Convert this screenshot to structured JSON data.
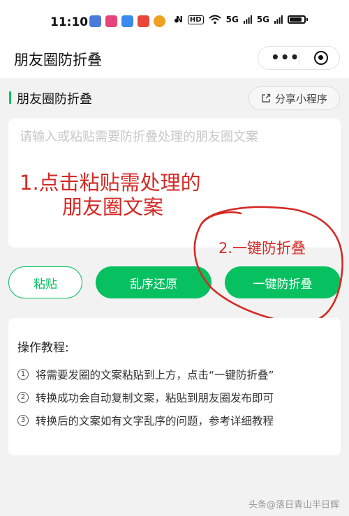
{
  "status": {
    "time": "11:10",
    "right_items": [
      "N",
      "HD",
      "5G",
      "5G"
    ]
  },
  "nav": {
    "title": "朋友圈防折叠",
    "menu_dots": "•••"
  },
  "section": {
    "title": "朋友圈防折叠",
    "share_label": "分享小程序"
  },
  "input": {
    "placeholder": "请输入或粘贴需要防折叠处理的朋友圈文案"
  },
  "annotations": {
    "step1_line1": "1.点击粘贴需处理的",
    "step1_line2": "朋友圈文案",
    "step2": "2.一键防折叠"
  },
  "buttons": {
    "paste": "粘贴",
    "restore": "乱序还原",
    "fold": "一键防折叠"
  },
  "tutorial": {
    "title": "操作教程:",
    "steps": [
      {
        "num": "1",
        "text": "将需要发圈的文案粘贴到上方，点击“一键防折叠”"
      },
      {
        "num": "2",
        "text": "转换成功会自动复制文案，粘贴到朋友圈发布即可"
      },
      {
        "num": "3",
        "text": "转换后的文案如有文字乱序的问题，参考详细教程"
      }
    ]
  },
  "watermark": "头条@落日青山半日辉",
  "colors": {
    "accent": "#07c160",
    "annotation": "#d42a25"
  }
}
